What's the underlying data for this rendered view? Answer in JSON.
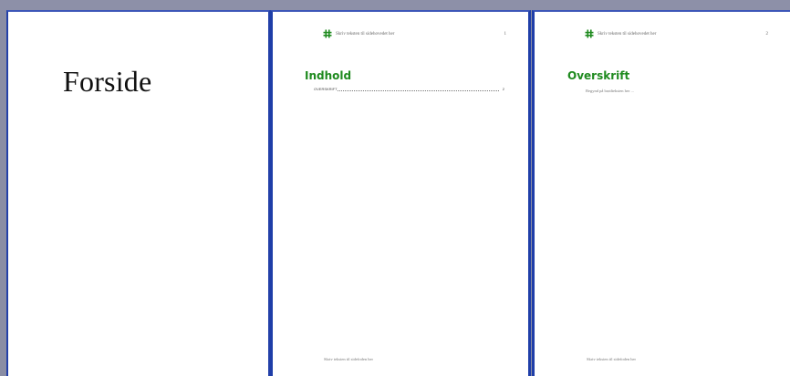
{
  "document": {
    "pages": [
      {
        "title": "Forside"
      },
      {
        "header_text": "Skriv teksten til sidehovedet her",
        "page_number": "1",
        "heading": "Indhold",
        "toc": [
          {
            "label": "OVERSKRIFT",
            "page": "2"
          }
        ],
        "footer_text": "Skriv teksten til sidefoden her"
      },
      {
        "header_text": "Skriv teksten til sidehovedet her",
        "page_number": "2",
        "heading": "Overskrift",
        "body_text": "Begynd på brødteksten her ...",
        "footer_text": "Skriv teksten til sidefoden her"
      }
    ]
  },
  "colors": {
    "workspace": "#8a8da4",
    "page_border": "#2340a8",
    "heading": "#1e8a1e",
    "logo": "#1e8a1e"
  },
  "icons": {
    "header_logo": "green-hash-logo-icon"
  }
}
